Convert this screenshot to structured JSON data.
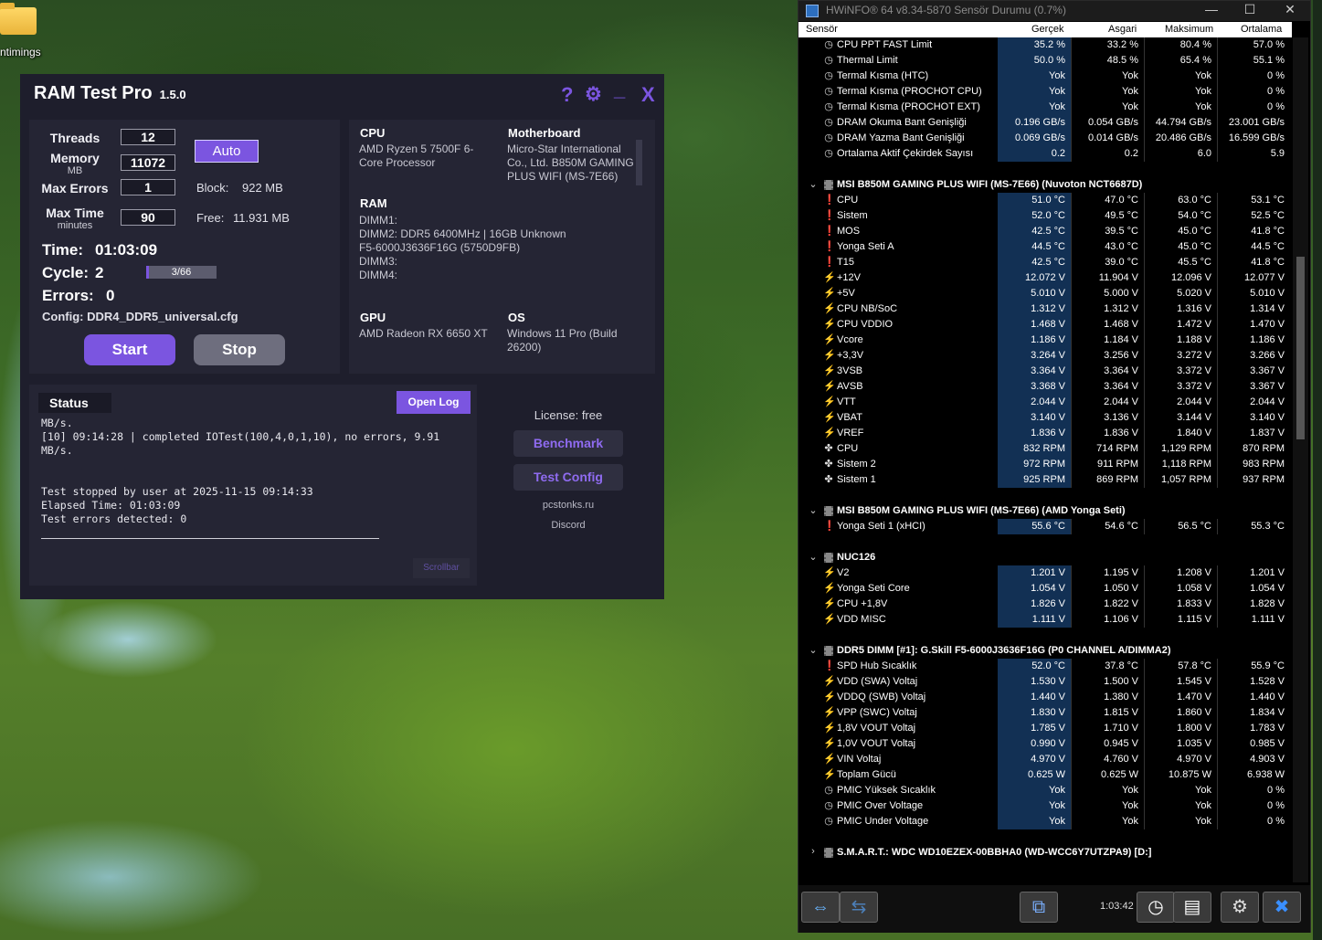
{
  "desktop": {
    "icon_label": "ntimings"
  },
  "ramtest": {
    "title": "RAM Test Pro",
    "version": "1.5.0",
    "controls": {
      "help": "?",
      "settings": "⚙",
      "minimize": "_",
      "close": "X"
    },
    "settings_panel": {
      "threads_label": "Threads",
      "threads_value": "12",
      "memory_label": "Memory",
      "memory_unit": "MB",
      "memory_value": "11072",
      "auto_label": "Auto",
      "max_errors_label": "Max Errors",
      "max_errors_value": "1",
      "block_label": "Block:",
      "block_value": "922 MB",
      "max_time_label": "Max Time",
      "max_time_unit": "minutes",
      "max_time_value": "90",
      "free_label": "Free:",
      "free_value": "11.931 MB",
      "time_label": "Time:",
      "time_value": "01:03:09",
      "cycle_label": "Cycle:",
      "cycle_value": "2",
      "cycle_progress_text": "3/66",
      "cycle_progress": 0.045,
      "errors_label": "Errors:",
      "errors_value": "0",
      "config_text": "Config: DDR4_DDR5_universal.cfg",
      "start_label": "Start",
      "stop_label": "Stop"
    },
    "system_info": {
      "cpu_h": "CPU",
      "cpu_v": "AMD Ryzen 5 7500F 6-\nCore Processor",
      "mb_h": "Motherboard",
      "mb_v": "Micro-Star International\nCo., Ltd. B850M GAMING\nPLUS WIFI (MS-7E66)",
      "ram_h": "RAM",
      "ram_v": "DIMM1:\nDIMM2: DDR5 6400MHz | 16GB Unknown\nF5-6000J3636F16G (5750D9FB)\nDIMM3:\nDIMM4:",
      "gpu_h": "GPU",
      "gpu_v": "AMD Radeon RX 6650 XT",
      "os_h": "OS",
      "os_v": "Windows 11 Pro (Build\n26200)"
    },
    "status": {
      "title": "Status",
      "open_log": "Open Log",
      "log": "MB/s.\n[10] 09:14:28 | completed IOTest(100,4,0,1,10), no errors, 9.91\nMB/s.\n\n\nTest stopped by user at 2025-11-15 09:14:33\nElapsed Time: 01:03:09\nTest errors detected: 0",
      "scrollbar_label": "Scrollbar"
    },
    "side": {
      "license": "License: free",
      "benchmark": "Benchmark",
      "test_config": "Test Config",
      "site": "pcstonks.ru",
      "discord": "Discord"
    }
  },
  "hwinfo": {
    "title": "HWiNFO® 64 v8.34-5870 Sensör Durumu (0.7%)",
    "columns": [
      "Sensör",
      "Gerçek",
      "Asgari",
      "Maksimum",
      "Ortalama"
    ],
    "rows": [
      {
        "t": "clock",
        "n": "CPU PPT FAST Limit",
        "v": [
          "35.2 %",
          "33.2 %",
          "80.4 %",
          "57.0 %"
        ]
      },
      {
        "t": "clock",
        "n": "Thermal Limit",
        "v": [
          "50.0 %",
          "48.5 %",
          "65.4 %",
          "55.1 %"
        ]
      },
      {
        "t": "clock",
        "n": "Termal Kısma (HTC)",
        "v": [
          "Yok",
          "Yok",
          "Yok",
          "0 %"
        ]
      },
      {
        "t": "clock",
        "n": "Termal Kısma (PROCHOT CPU)",
        "v": [
          "Yok",
          "Yok",
          "Yok",
          "0 %"
        ]
      },
      {
        "t": "clock",
        "n": "Termal Kısma (PROCHOT EXT)",
        "v": [
          "Yok",
          "Yok",
          "Yok",
          "0 %"
        ]
      },
      {
        "t": "clock",
        "n": "DRAM Okuma Bant Genişliği",
        "v": [
          "0.196 GB/s",
          "0.054 GB/s",
          "44.794 GB/s",
          "23.001 GB/s"
        ]
      },
      {
        "t": "clock",
        "n": "DRAM Yazma Bant Genişliği",
        "v": [
          "0.069 GB/s",
          "0.014 GB/s",
          "20.486 GB/s",
          "16.599 GB/s"
        ]
      },
      {
        "t": "clock",
        "n": "Ortalama Aktif Çekirdek Sayısı",
        "v": [
          "0.2",
          "0.2",
          "6.0",
          "5.9"
        ]
      },
      {
        "t": "gap"
      },
      {
        "t": "sec",
        "n": "MSI B850M GAMING PLUS WIFI (MS-7E66) (Nuvoton NCT6687D)"
      },
      {
        "t": "temp",
        "n": "CPU",
        "v": [
          "51.0 °C",
          "47.0 °C",
          "63.0 °C",
          "53.1 °C"
        ]
      },
      {
        "t": "temp",
        "n": "Sistem",
        "v": [
          "52.0 °C",
          "49.5 °C",
          "54.0 °C",
          "52.5 °C"
        ]
      },
      {
        "t": "temp",
        "n": "MOS",
        "v": [
          "42.5 °C",
          "39.5 °C",
          "45.0 °C",
          "41.8 °C"
        ]
      },
      {
        "t": "temp",
        "n": "Yonga Seti A",
        "v": [
          "44.5 °C",
          "43.0 °C",
          "45.0 °C",
          "44.5 °C"
        ]
      },
      {
        "t": "temp",
        "n": "T15",
        "v": [
          "42.5 °C",
          "39.0 °C",
          "45.5 °C",
          "41.8 °C"
        ]
      },
      {
        "t": "volt",
        "n": "+12V",
        "v": [
          "12.072 V",
          "11.904 V",
          "12.096 V",
          "12.077 V"
        ]
      },
      {
        "t": "volt",
        "n": "+5V",
        "v": [
          "5.010 V",
          "5.000 V",
          "5.020 V",
          "5.010 V"
        ]
      },
      {
        "t": "volt",
        "n": "CPU NB/SoC",
        "v": [
          "1.312 V",
          "1.312 V",
          "1.316 V",
          "1.314 V"
        ]
      },
      {
        "t": "volt",
        "n": "CPU VDDIO",
        "v": [
          "1.468 V",
          "1.468 V",
          "1.472 V",
          "1.470 V"
        ]
      },
      {
        "t": "volt",
        "n": "Vcore",
        "v": [
          "1.186 V",
          "1.184 V",
          "1.188 V",
          "1.186 V"
        ]
      },
      {
        "t": "volt",
        "n": "+3,3V",
        "v": [
          "3.264 V",
          "3.256 V",
          "3.272 V",
          "3.266 V"
        ]
      },
      {
        "t": "volt",
        "n": "3VSB",
        "v": [
          "3.364 V",
          "3.364 V",
          "3.372 V",
          "3.367 V"
        ]
      },
      {
        "t": "volt",
        "n": "AVSB",
        "v": [
          "3.368 V",
          "3.364 V",
          "3.372 V",
          "3.367 V"
        ]
      },
      {
        "t": "volt",
        "n": "VTT",
        "v": [
          "2.044 V",
          "2.044 V",
          "2.044 V",
          "2.044 V"
        ]
      },
      {
        "t": "volt",
        "n": "VBAT",
        "v": [
          "3.140 V",
          "3.136 V",
          "3.144 V",
          "3.140 V"
        ]
      },
      {
        "t": "volt",
        "n": "VREF",
        "v": [
          "1.836 V",
          "1.836 V",
          "1.840 V",
          "1.837 V"
        ]
      },
      {
        "t": "fan",
        "n": "CPU",
        "v": [
          "832 RPM",
          "714 RPM",
          "1,129 RPM",
          "870 RPM"
        ]
      },
      {
        "t": "fan",
        "n": "Sistem 2",
        "v": [
          "972 RPM",
          "911 RPM",
          "1,118 RPM",
          "983 RPM"
        ]
      },
      {
        "t": "fan",
        "n": "Sistem 1",
        "v": [
          "925 RPM",
          "869 RPM",
          "1,057 RPM",
          "937 RPM"
        ]
      },
      {
        "t": "gap"
      },
      {
        "t": "sec",
        "n": "MSI B850M GAMING PLUS WIFI (MS-7E66) (AMD Yonga Seti)"
      },
      {
        "t": "temp",
        "n": "Yonga Seti 1 (xHCI)",
        "v": [
          "55.6 °C",
          "54.6 °C",
          "56.5 °C",
          "55.3 °C"
        ]
      },
      {
        "t": "gap"
      },
      {
        "t": "sec",
        "n": "NUC126"
      },
      {
        "t": "volt",
        "n": "V2",
        "v": [
          "1.201 V",
          "1.195 V",
          "1.208 V",
          "1.201 V"
        ]
      },
      {
        "t": "volt",
        "n": "Yonga Seti Core",
        "v": [
          "1.054 V",
          "1.050 V",
          "1.058 V",
          "1.054 V"
        ]
      },
      {
        "t": "volt",
        "n": "CPU +1,8V",
        "v": [
          "1.826 V",
          "1.822 V",
          "1.833 V",
          "1.828 V"
        ]
      },
      {
        "t": "volt",
        "n": "VDD MISC",
        "v": [
          "1.111 V",
          "1.106 V",
          "1.115 V",
          "1.111 V"
        ]
      },
      {
        "t": "gap"
      },
      {
        "t": "sec",
        "n": "DDR5 DIMM [#1]: G.Skill F5-6000J3636F16G (P0 CHANNEL A/DIMMA2)"
      },
      {
        "t": "temp",
        "n": "SPD Hub Sıcaklık",
        "v": [
          "52.0 °C",
          "37.8 °C",
          "57.8 °C",
          "55.9 °C"
        ]
      },
      {
        "t": "volt",
        "n": "VDD (SWA) Voltaj",
        "v": [
          "1.530 V",
          "1.500 V",
          "1.545 V",
          "1.528 V"
        ]
      },
      {
        "t": "volt",
        "n": "VDDQ (SWB) Voltaj",
        "v": [
          "1.440 V",
          "1.380 V",
          "1.470 V",
          "1.440 V"
        ]
      },
      {
        "t": "volt",
        "n": "VPP (SWC) Voltaj",
        "v": [
          "1.830 V",
          "1.815 V",
          "1.860 V",
          "1.834 V"
        ]
      },
      {
        "t": "volt",
        "n": "1,8V VOUT Voltaj",
        "v": [
          "1.785 V",
          "1.710 V",
          "1.800 V",
          "1.783 V"
        ]
      },
      {
        "t": "volt",
        "n": "1,0V VOUT Voltaj",
        "v": [
          "0.990 V",
          "0.945 V",
          "1.035 V",
          "0.985 V"
        ]
      },
      {
        "t": "volt",
        "n": "VIN Voltaj",
        "v": [
          "4.970 V",
          "4.760 V",
          "4.970 V",
          "4.903 V"
        ]
      },
      {
        "t": "volt",
        "n": "Toplam Gücü",
        "v": [
          "0.625 W",
          "0.625 W",
          "10.875 W",
          "6.938 W"
        ]
      },
      {
        "t": "clock",
        "n": "PMIC Yüksek Sıcaklık",
        "v": [
          "Yok",
          "Yok",
          "Yok",
          "0 %"
        ]
      },
      {
        "t": "clock",
        "n": "PMIC Over Voltage",
        "v": [
          "Yok",
          "Yok",
          "Yok",
          "0 %"
        ]
      },
      {
        "t": "clock",
        "n": "PMIC Under Voltage",
        "v": [
          "Yok",
          "Yok",
          "Yok",
          "0 %"
        ]
      },
      {
        "t": "gap"
      },
      {
        "t": "sec-collapsed",
        "n": "S.M.A.R.T.: WDC WD10EZEX-00BBHA0 (WD-WCC6Y7UTZPA9) [D:]"
      }
    ],
    "footer": {
      "clock": "1:03:42"
    }
  }
}
